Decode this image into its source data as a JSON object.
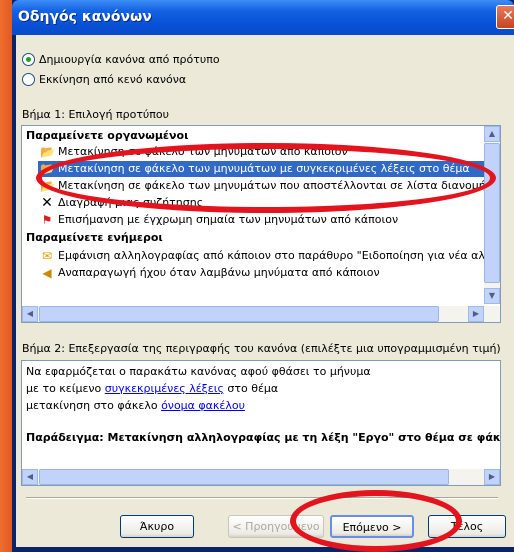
{
  "window": {
    "title": "Οδηγός κανόνων",
    "close_glyph": "✕"
  },
  "options": [
    {
      "label": "Δημιουργία κανόνα από πρότυπο",
      "selected": true
    },
    {
      "label": "Εκκίνηση από κενό κανόνα",
      "selected": false
    }
  ],
  "step1": {
    "heading": "Βήμα 1: Επιλογή προτύπου",
    "groups": [
      {
        "title": "Παραμείνετε οργανωμένοι",
        "items": [
          {
            "label": "Μετακίνηση σε φάκελο των μηνυμάτων από κάποιον",
            "icon": "envelope-folder-icon"
          },
          {
            "label": "Μετακίνηση σε φάκελο των μηνυμάτων με συγκεκριμένες λέξεις στο θέμα",
            "icon": "envelope-folder-icon",
            "selected": true
          },
          {
            "label": "Μετακίνηση σε φάκελο των μηνυμάτων που αποστέλλονται σε λίστα διανομής",
            "icon": "envelope-folder-icon"
          },
          {
            "label": "Διαγραφή μιας συζήτησης",
            "icon": "delete-x-icon"
          },
          {
            "label": "Επισήμανση με έγχρωμη σημαία των μηνυμάτων από κάποιον",
            "icon": "red-flag-icon"
          }
        ]
      },
      {
        "title": "Παραμείνετε ενήμεροι",
        "items": [
          {
            "label": "Εμφάνιση αλληλογραφίας από κάποιον στο  παράθυρο \"Ειδοποίηση για νέα αλληλογραφία\"",
            "icon": "new-mail-alert-icon"
          },
          {
            "label": "Αναπαραγωγή ήχου όταν λαμβάνω μηνύματα από κάποιον",
            "icon": "speaker-icon"
          }
        ]
      }
    ]
  },
  "step2": {
    "heading": "Βήμα 2: Επεξεργασία της περιγραφής του κανόνα (επιλέξτε μια υπογραμμισμένη τιμή)",
    "line1": "Να εφαρμόζεται ο παρακάτω κανόνας αφού φθάσει το μήνυμα",
    "line2_pre": "με το κείμενο ",
    "line2_link": "συγκεκριμένες λέξεις",
    "line2_post": " στο θέμα",
    "line3_pre": "μετακίνηση στο φάκελο ",
    "line3_link": "όνομα φακέλου",
    "example": "Παράδειγμα: Μετακίνηση αλληλογραφίας με τη λέξη \"Εργο\" στο θέμα σε φάκελο"
  },
  "buttons": {
    "cancel": "Άκυρο",
    "back": "< Προηγούμενο",
    "next": "Επόμενο >",
    "finish": "Τέλος"
  },
  "colors": {
    "selection": "#316ac5",
    "annotation": "#e4141f"
  }
}
